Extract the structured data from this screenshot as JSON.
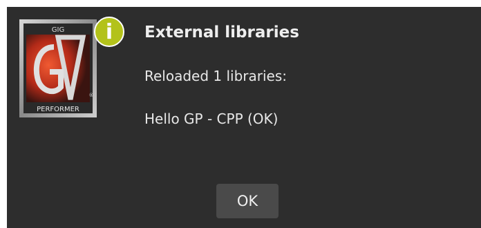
{
  "dialog": {
    "title": "External libraries",
    "line1": "Reloaded 1 libraries:",
    "line2": "Hello GP - CPP (OK)",
    "ok_label": "OK"
  },
  "logo": {
    "top_text": "GIG",
    "bottom_text": "PERFORMER",
    "mark_text": "GP",
    "registered": "®"
  },
  "badge": {
    "icon": "info-icon",
    "glyph": "i",
    "color": "#b3c21a"
  },
  "colors": {
    "dialog_bg": "#2d2d2d",
    "button_bg": "#4a4a4a",
    "text": "#eeeeee",
    "logo_red": "#c8321e"
  }
}
